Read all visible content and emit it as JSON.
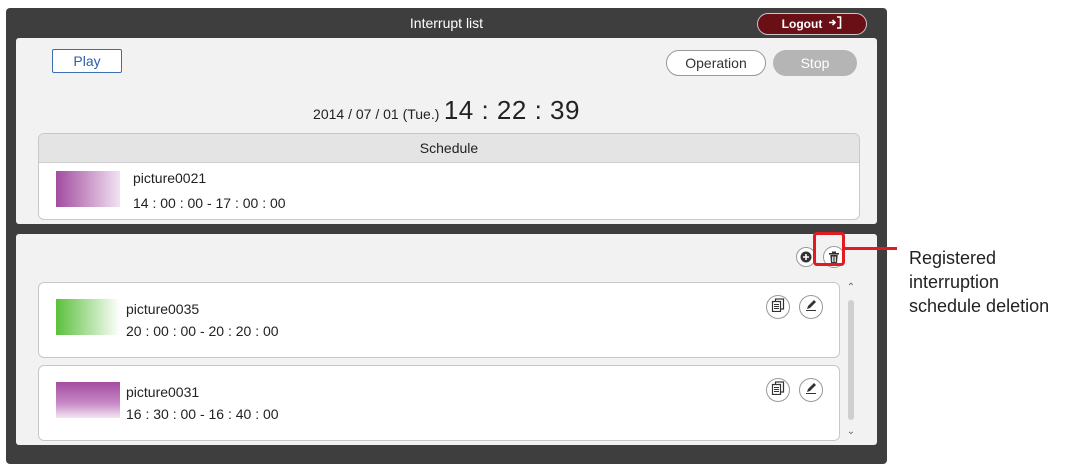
{
  "window": {
    "title": "Interrupt list",
    "logout_label": "Logout"
  },
  "controls": {
    "play_label": "Play",
    "operation_label": "Operation",
    "stop_label": "Stop"
  },
  "datetime": {
    "date": "2014 / 07 / 01 (Tue.)",
    "time": "14 : 22 : 39"
  },
  "schedule": {
    "header": "Schedule",
    "item": {
      "name": "picture0021",
      "time": "14 : 00 : 00 - 17 : 00 : 00",
      "thumb_color": "#a24ca0"
    }
  },
  "interrupts": [
    {
      "name": "picture0035",
      "time": "20 : 00 : 00 - 20 : 20 : 00",
      "thumb_color": "#5cbf3c"
    },
    {
      "name": "picture0031",
      "time": "16 : 30 : 00 - 16 : 40 : 00",
      "thumb_color": "#a24ca0"
    }
  ],
  "annotation": {
    "line1": "Registered",
    "line2": "interruption",
    "line3": "schedule deletion"
  },
  "icons": {
    "logout": "logout-icon",
    "add": "add-icon",
    "delete": "trash-icon",
    "copy": "copy-icon",
    "edit": "edit-icon",
    "scroll_up": "chevron-up-icon",
    "scroll_down": "chevron-down-icon"
  },
  "colors": {
    "accent_red": "#e21b23",
    "logout_bg": "#6b0f16",
    "play_border": "#3a6fb0"
  }
}
